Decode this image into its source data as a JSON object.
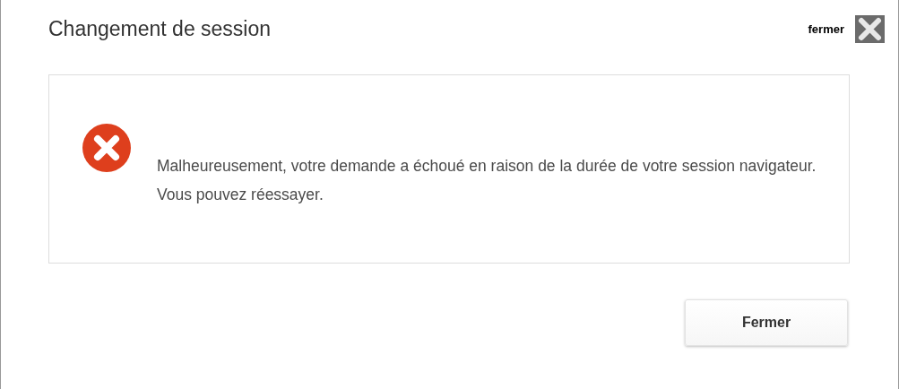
{
  "dialog": {
    "title": "Changement de session",
    "close_label": "fermer",
    "message": "Malheureusement, votre demande a échoué en raison de la durée de votre session navigateur. Vous pouvez réessayer.",
    "buttons": [
      "Fermer"
    ]
  }
}
